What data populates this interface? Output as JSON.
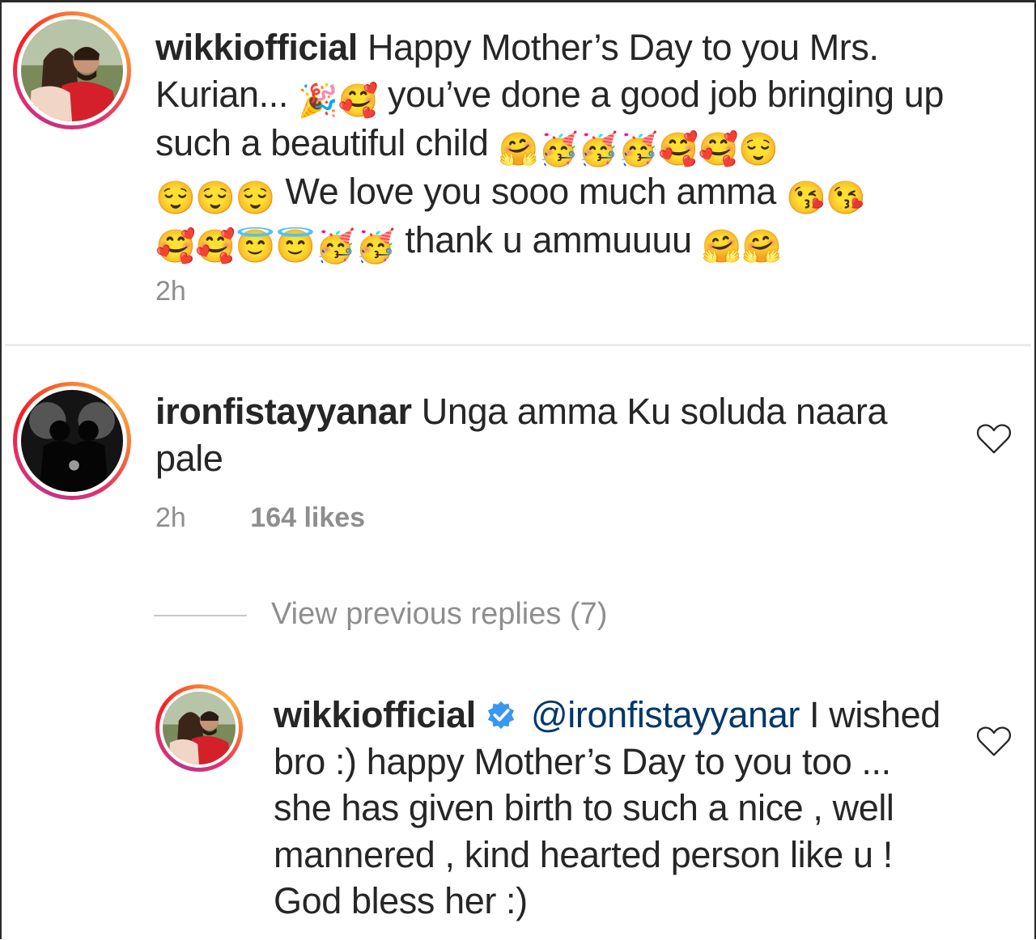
{
  "comments": [
    {
      "username": "wikkiofficial",
      "text_segments": [
        "Happy Mother’s Day to you Mrs. Kurian...",
        "you’ve done a good job bringing up such a beautiful child",
        "We love you sooo much amma",
        "thank u ammuuuu"
      ],
      "emoji_groups": [
        "🎉🥰",
        "🤗🥳🥳🥳🥰🥰😌",
        "😌😌😌",
        "😘😘",
        "🥰🥰😇😇🥳🥳",
        "🤗🤗"
      ],
      "time": "2h"
    },
    {
      "username": "ironfistayyanar",
      "text": "Unga amma Ku soluda naara pale",
      "time": "2h",
      "likes": "164 likes"
    }
  ],
  "view_previous_replies": "View previous replies (7)",
  "reply": {
    "username": "wikkiofficial",
    "verified": true,
    "mention": "@ironfistayyanar",
    "text": "I wished bro :) happy Mother’s Day to you too ... she has given birth to such a nice , well mannered , kind hearted person like u ! God bless her :)"
  },
  "icons": {
    "like": "heart-outline-icon",
    "verified": "verified-badge-icon"
  },
  "colors": {
    "username": "#262626",
    "secondary": "#8e8e8e",
    "mention": "#00376b",
    "verified_badge": "#3897f0"
  }
}
